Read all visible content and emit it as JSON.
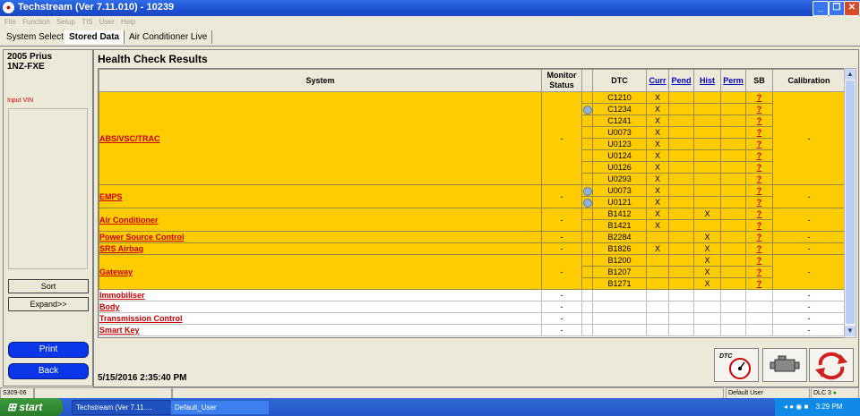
{
  "window": {
    "title": "Techstream (Ver 7.11.010) - 10239"
  },
  "menu": [
    "File",
    "Function",
    "Setup",
    "TIS",
    "User",
    "Help"
  ],
  "tabs": [
    "System Select",
    "Stored Data",
    "Air Conditioner Live"
  ],
  "vehicle": {
    "line1": "2005 Prius",
    "line2": "1NZ-FXE"
  },
  "left": {
    "input_vin": "Input VIN",
    "sort": "Sort",
    "expand": "Expand>>",
    "print": "Print",
    "back": "Back"
  },
  "main": {
    "title": "Health Check Results",
    "timestamp": "5/15/2016 2:35:40 PM"
  },
  "table": {
    "headers": {
      "system": "System",
      "monitor": "Monitor Status",
      "dtc": "DTC",
      "curr": "Curr",
      "pend": "Pend",
      "hist": "Hist",
      "perm": "Perm",
      "sb": "SB",
      "calibration": "Calibration"
    },
    "dash": "-",
    "x": "X",
    "sb_mark": "?",
    "systems": [
      "ABS/VSC/TRAC",
      "EMPS",
      "Air Conditioner",
      "Power Source Control",
      "SRS Airbag",
      "Gateway",
      "Immobiliser",
      "Body",
      "Transmission Control",
      "Smart Key"
    ],
    "dtcs": [
      "C1210",
      "C1234",
      "C1241",
      "U0073",
      "U0123",
      "U0124",
      "U0126",
      "U0293",
      "U0073",
      "U0121",
      "B1412",
      "B1421",
      "B2284",
      "B1826",
      "B1200",
      "B1207",
      "B1271"
    ]
  },
  "status": {
    "code": "S309-06",
    "user": "Default User",
    "dlc": "DLC 3"
  },
  "taskbar": {
    "start": "start",
    "task1": "Techstream (Ver 7.11....",
    "task2": "Default_User",
    "time": "3:29 PM"
  },
  "colors": {
    "highlight": "#ffcc00",
    "link_red": "#cc0000",
    "button_blue": "#0b36e8"
  }
}
